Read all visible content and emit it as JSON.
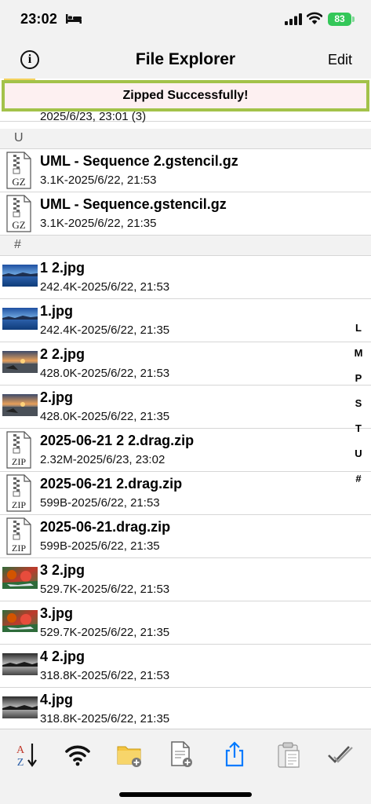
{
  "status": {
    "time": "23:02",
    "battery": "83"
  },
  "nav": {
    "title": "File Explorer",
    "edit_label": "Edit",
    "info_label": "i"
  },
  "toast": {
    "message": "Zipped Successfully!"
  },
  "list": {
    "partial_row": {
      "subtitle": "2025/6/23, 23:01 (3)"
    },
    "section_u": "U",
    "section_hash": "#",
    "files": [
      {
        "title": "UML - Sequence 2.gstencil.gz",
        "subtitle": "3.1K-2025/6/22, 21:53",
        "icon": "gz-file-icon"
      },
      {
        "title": "UML - Sequence.gstencil.gz",
        "subtitle": "3.1K-2025/6/22, 21:35",
        "icon": "gz-file-icon"
      },
      {
        "title": "1 2.jpg",
        "subtitle": "242.4K-2025/6/22, 21:53",
        "icon": "lake-thumbnail"
      },
      {
        "title": "1.jpg",
        "subtitle": "242.4K-2025/6/22, 21:35",
        "icon": "lake-thumbnail"
      },
      {
        "title": "2 2.jpg",
        "subtitle": "428.0K-2025/6/22, 21:53",
        "icon": "sunset-thumbnail"
      },
      {
        "title": "2.jpg",
        "subtitle": "428.0K-2025/6/22, 21:35",
        "icon": "sunset-thumbnail"
      },
      {
        "title": "2025-06-21 2 2.drag.zip",
        "subtitle": "2.32M-2025/6/23, 23:02",
        "icon": "zip-file-icon"
      },
      {
        "title": "2025-06-21 2.drag.zip",
        "subtitle": "599B-2025/6/22, 21:53",
        "icon": "zip-file-icon"
      },
      {
        "title": "2025-06-21.drag.zip",
        "subtitle": "599B-2025/6/22, 21:35",
        "icon": "zip-file-icon"
      },
      {
        "title": "3 2.jpg",
        "subtitle": "529.7K-2025/6/22, 21:53",
        "icon": "autumn-thumbnail"
      },
      {
        "title": "3.jpg",
        "subtitle": "529.7K-2025/6/22, 21:35",
        "icon": "autumn-thumbnail"
      },
      {
        "title": "4 2.jpg",
        "subtitle": "318.8K-2025/6/22, 21:53",
        "icon": "bw-thumbnail"
      },
      {
        "title": "4.jpg",
        "subtitle": "318.8K-2025/6/22, 21:35",
        "icon": "bw-thumbnail"
      }
    ]
  },
  "index": [
    "L",
    "M",
    "P",
    "S",
    "T",
    "U",
    "#"
  ],
  "toolbar": {
    "sort_label_a": "A",
    "sort_label_z": "Z",
    "gz_label": "GZ",
    "zip_label": "ZIP",
    "icons": [
      "sort-az-icon",
      "wifi-share-icon",
      "new-folder-icon",
      "new-file-icon",
      "share-icon",
      "paste-icon",
      "select-icon"
    ]
  },
  "colors": {
    "accent": "#007aff",
    "toast_border": "#a3c24a",
    "toast_bg": "#fdf0f1",
    "battery": "#34c759",
    "folder": "#f4d35e"
  }
}
